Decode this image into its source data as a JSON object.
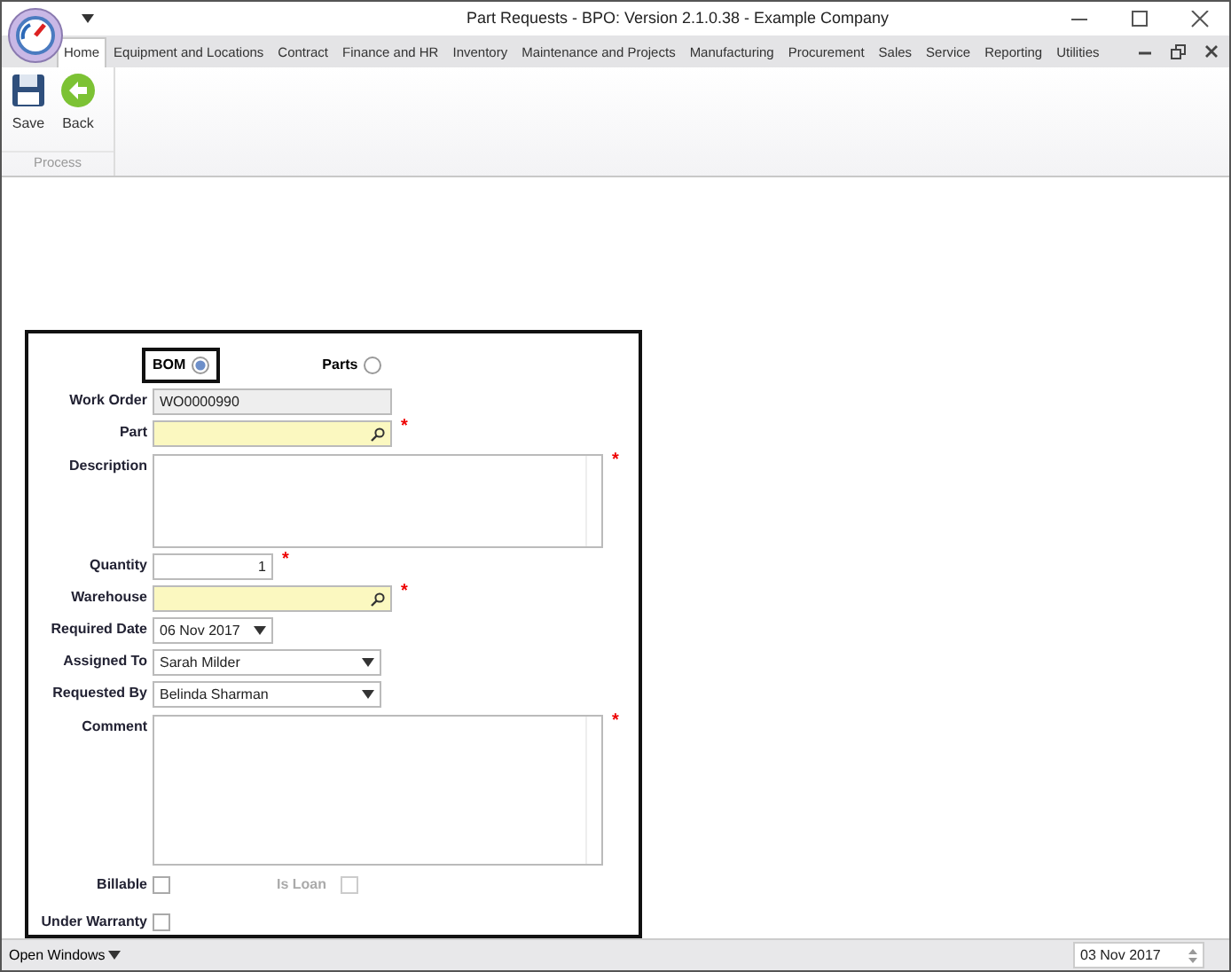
{
  "window": {
    "title": "Part Requests - BPO: Version 2.1.0.38 - Example Company"
  },
  "tabs": [
    {
      "label": "Home",
      "selected": true
    },
    {
      "label": "Equipment and Locations",
      "selected": false
    },
    {
      "label": "Contract",
      "selected": false
    },
    {
      "label": "Finance and HR",
      "selected": false
    },
    {
      "label": "Inventory",
      "selected": false
    },
    {
      "label": "Maintenance and Projects",
      "selected": false
    },
    {
      "label": "Manufacturing",
      "selected": false
    },
    {
      "label": "Procurement",
      "selected": false
    },
    {
      "label": "Sales",
      "selected": false
    },
    {
      "label": "Service",
      "selected": false
    },
    {
      "label": "Reporting",
      "selected": false
    },
    {
      "label": "Utilities",
      "selected": false
    }
  ],
  "ribbon": {
    "group": "Process",
    "buttons": [
      {
        "kind": "save",
        "label": "Save"
      },
      {
        "kind": "back",
        "label": "Back"
      }
    ]
  },
  "form": {
    "modes": [
      {
        "label": "BOM",
        "selected": true,
        "focused": true
      },
      {
        "label": "Parts",
        "selected": false,
        "focused": false
      }
    ],
    "fields": [
      {
        "label": "Work Order",
        "kind": "readonly",
        "value": "WO0000990"
      },
      {
        "label": "Part",
        "kind": "lookup",
        "required_mark": "*"
      },
      {
        "label": "Description",
        "kind": "textarea",
        "required_mark": "*"
      },
      {
        "label": "Quantity",
        "kind": "number",
        "value": "1",
        "required_mark": "*"
      },
      {
        "label": "Warehouse",
        "kind": "lookup",
        "required_mark": "*"
      },
      {
        "label": "Required Date",
        "kind": "date",
        "value": "06 Nov 2017"
      },
      {
        "label": "Assigned To",
        "kind": "dropdown",
        "value": "Sarah Milder"
      },
      {
        "label": "Requested By",
        "kind": "dropdown",
        "value": "Belinda Sharman"
      },
      {
        "label": "Comment",
        "kind": "textarea",
        "required_mark": "*"
      }
    ],
    "checks": [
      {
        "label": "Billable",
        "checked": false,
        "disabled": false
      },
      {
        "label": "Is Loan",
        "checked": false,
        "disabled": true
      },
      {
        "label": "Under Warranty",
        "checked": false,
        "disabled": false
      }
    ]
  },
  "status_bar": {
    "menu": "Open Windows",
    "date": "03 Nov 2017"
  }
}
